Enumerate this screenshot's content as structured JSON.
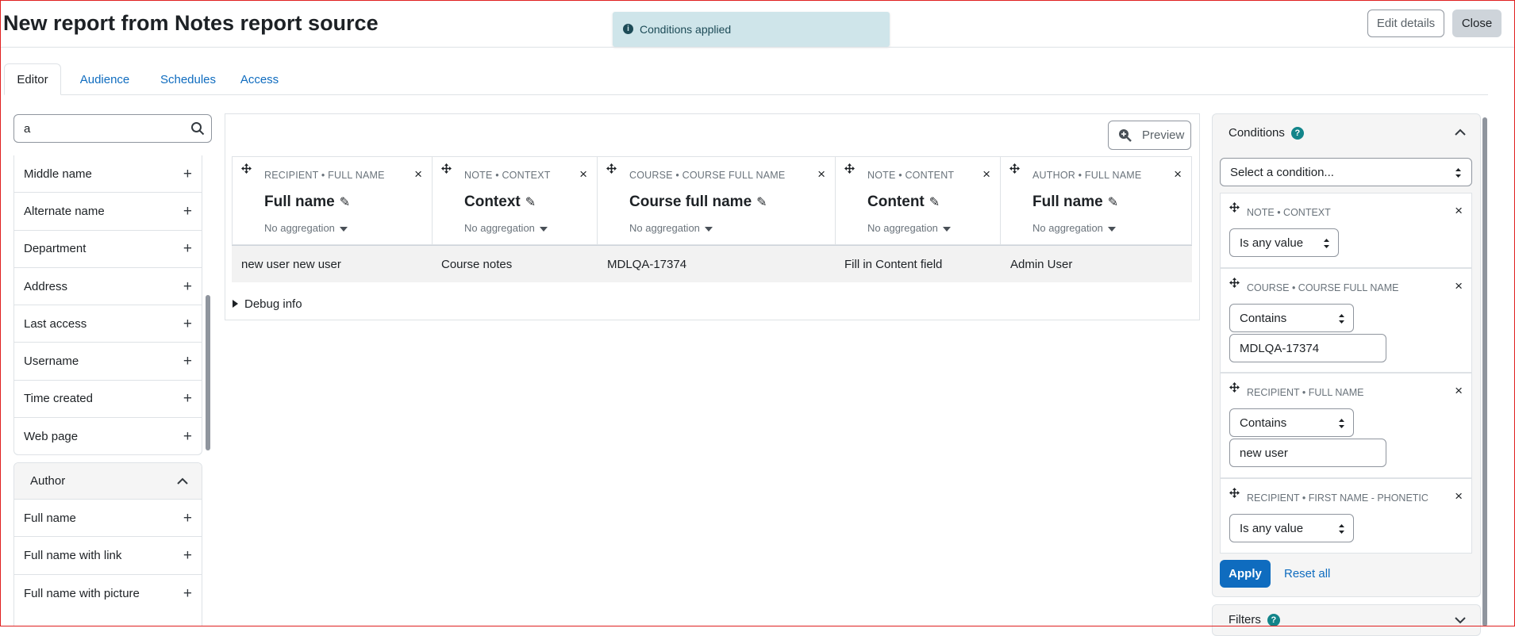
{
  "page": {
    "title": "New report from Notes report source"
  },
  "toast": {
    "message": "Conditions applied"
  },
  "header": {
    "edit_label": "Edit details",
    "close_label": "Close"
  },
  "tabs": [
    {
      "label": "Editor",
      "active": true
    },
    {
      "label": "Audience",
      "active": false
    },
    {
      "label": "Schedules",
      "active": false
    },
    {
      "label": "Access",
      "active": false
    }
  ],
  "sidebar": {
    "search_value": "a",
    "items": [
      "Middle name",
      "Alternate name",
      "Department",
      "Address",
      "Last access",
      "Username",
      "Time created",
      "Web page"
    ],
    "author_section": {
      "title": "Author",
      "items": [
        "Full name",
        "Full name with link",
        "Full name with picture"
      ]
    }
  },
  "editor": {
    "preview_label": "Preview",
    "columns": [
      {
        "caption": "RECIPIENT • FULL NAME",
        "name": "Full name",
        "aggregation": "No aggregation"
      },
      {
        "caption": "NOTE • CONTEXT",
        "name": "Context",
        "aggregation": "No aggregation"
      },
      {
        "caption": "COURSE • COURSE FULL NAME",
        "name": "Course full name",
        "aggregation": "No aggregation"
      },
      {
        "caption": "NOTE • CONTENT",
        "name": "Content",
        "aggregation": "No aggregation"
      },
      {
        "caption": "AUTHOR • FULL NAME",
        "name": "Full name",
        "aggregation": "No aggregation"
      }
    ],
    "rows": [
      [
        "new user new user",
        "Course notes",
        "MDLQA-17374",
        "Fill in Content field",
        "Admin User"
      ]
    ],
    "debug_label": "Debug info"
  },
  "conditions": {
    "title": "Conditions",
    "select_placeholder": "Select a condition...",
    "items": [
      {
        "caption": "NOTE • CONTEXT",
        "operator": "Is any value",
        "value": ""
      },
      {
        "caption": "COURSE • COURSE FULL NAME",
        "operator": "Contains",
        "value": "MDLQA-17374"
      },
      {
        "caption": "RECIPIENT • FULL NAME",
        "operator": "Contains",
        "value": "new user"
      },
      {
        "caption": "RECIPIENT • FIRST NAME - PHONETIC",
        "operator": "Is any value",
        "value": ""
      }
    ],
    "apply_label": "Apply",
    "reset_label": "Reset all"
  },
  "filters": {
    "title": "Filters"
  },
  "colors": {
    "primary": "#0f6cbf",
    "toast_bg": "#cfe5ea",
    "help": "#12858a"
  }
}
